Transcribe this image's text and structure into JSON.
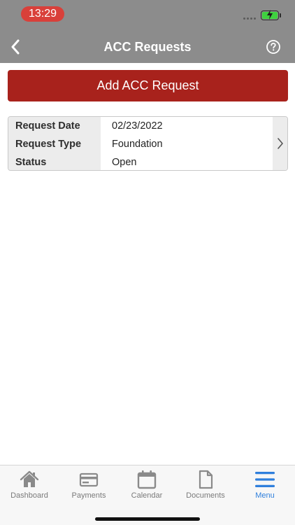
{
  "status_bar": {
    "time": "13:29"
  },
  "nav": {
    "title": "ACC Requests"
  },
  "add_button": {
    "label": "Add ACC Request"
  },
  "request": {
    "rows": [
      {
        "label": "Request Date",
        "value": "02/23/2022"
      },
      {
        "label": "Request Type",
        "value": "Foundation"
      },
      {
        "label": "Status",
        "value": "Open"
      }
    ]
  },
  "tabs": [
    {
      "label": "Dashboard",
      "icon": "home-icon"
    },
    {
      "label": "Payments",
      "icon": "credit-card-icon"
    },
    {
      "label": "Calendar",
      "icon": "calendar-icon"
    },
    {
      "label": "Documents",
      "icon": "document-icon"
    },
    {
      "label": "Menu",
      "icon": "hamburger-menu-icon"
    }
  ],
  "colors": {
    "header": "#8c8c8c",
    "accent_red": "#a8221c",
    "active_tab": "#2f7fdc",
    "time_pill": "#d9403a"
  }
}
